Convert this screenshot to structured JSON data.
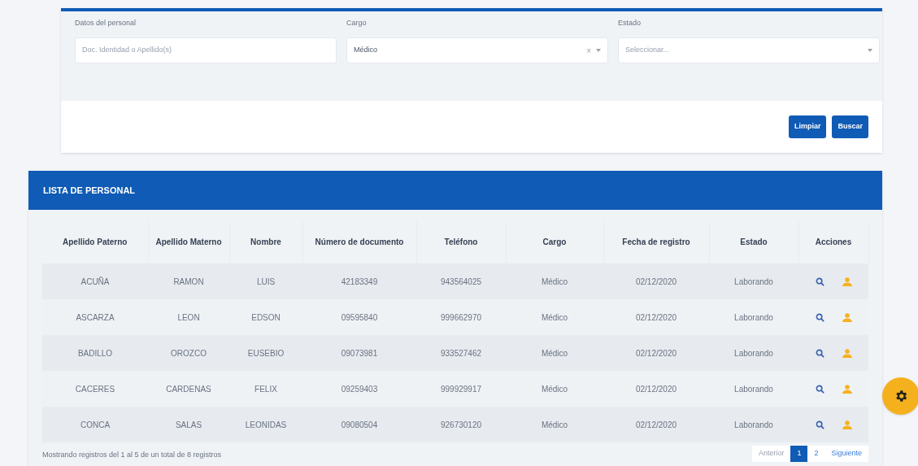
{
  "filters": {
    "fields": [
      {
        "kind": "text",
        "label": "Datos del personal",
        "placeholder": "Doc. Identidad o Apellido(s)"
      },
      {
        "kind": "select",
        "label": "Cargo",
        "value": "Médico",
        "clear": "×"
      },
      {
        "kind": "select",
        "label": "Estado",
        "placeholder": "Seleccionar..."
      }
    ],
    "buttons": [
      "Limpiar",
      "Buscar"
    ]
  },
  "list": {
    "title": "LISTA DE PERSONAL",
    "columns": [
      "Apellido Paterno",
      "Apellido Materno",
      "Nombre",
      "Número de documento",
      "Teléfono",
      "Cargo",
      "Fecha de registro",
      "Estado",
      "Acciones"
    ],
    "rows": [
      [
        "ACUÑA",
        "RAMON",
        "LUIS",
        "42183349",
        "943564025",
        "Médico",
        "02/12/2020",
        "Laborando"
      ],
      [
        "ASCARZA",
        "LEON",
        "EDSON",
        "09595840",
        "999662970",
        "Médico",
        "02/12/2020",
        "Laborando"
      ],
      [
        "BADILLO",
        "OROZCO",
        "EUSEBIO",
        "09073981",
        "933527462",
        "Médico",
        "02/12/2020",
        "Laborando"
      ],
      [
        "CACERES",
        "CARDENAS",
        "FELIX",
        "09259403",
        "999929917",
        "Médico",
        "02/12/2020",
        "Laborando"
      ],
      [
        "CONCA",
        "SALAS",
        "LEONIDAS",
        "09080504",
        "926730120",
        "Médico",
        "02/12/2020",
        "Laborando"
      ]
    ],
    "summary": "Mostrando registros del 1 al 5 de un total de 8 registros",
    "pagination": [
      {
        "label": "Anterior",
        "kind": "nav",
        "selected": false
      },
      {
        "label": "1",
        "kind": "page",
        "selected": true
      },
      {
        "label": "2",
        "kind": "page",
        "selected": false
      },
      {
        "label": "Siguiente",
        "kind": "nav",
        "selected": false
      }
    ]
  }
}
